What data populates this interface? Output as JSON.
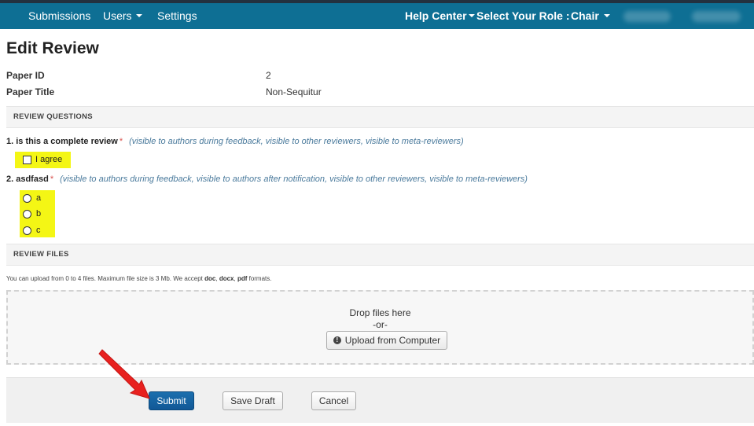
{
  "nav": {
    "submissions": "Submissions",
    "users": "Users",
    "settings": "Settings",
    "help_center": "Help Center",
    "select_role_label": "Select Your Role :",
    "role": "Chair"
  },
  "page": {
    "title": "Edit Review",
    "paper_id_label": "Paper ID",
    "paper_id_value": "2",
    "paper_title_label": "Paper Title",
    "paper_title_value": "Non-Sequitur"
  },
  "review_questions": {
    "header": "REVIEW QUESTIONS",
    "q1": {
      "text": "1. is this a complete review",
      "required": "*",
      "visibility": "(visible to authors during feedback, visible to other reviewers, visible to meta-reviewers)",
      "option": "I agree"
    },
    "q2": {
      "text": "2. asdfasd",
      "required": "*",
      "visibility": "(visible to authors during feedback, visible to authors after notification, visible to other reviewers, visible to meta-reviewers)",
      "options": [
        "a",
        "b",
        "c"
      ]
    }
  },
  "review_files": {
    "header": "REVIEW FILES",
    "help_prefix": "You can upload from 0 to 4 files. Maximum file size is 3 Mb. We accept ",
    "format_doc": "doc",
    "sep1": ", ",
    "format_docx": "docx",
    "sep2": ", ",
    "format_pdf": "pdf",
    "help_suffix": " formats.",
    "drop_text": "Drop files here",
    "or_text": "-or-",
    "upload_button": "Upload from Computer",
    "upload_icon": "info-circle-icon"
  },
  "actions": {
    "submit": "Submit",
    "save_draft": "Save Draft",
    "cancel": "Cancel"
  },
  "colors": {
    "navbar": "#0e6f94",
    "highlight": "#f4f615",
    "primary_button": "#125896",
    "arrow": "#e8211f"
  }
}
